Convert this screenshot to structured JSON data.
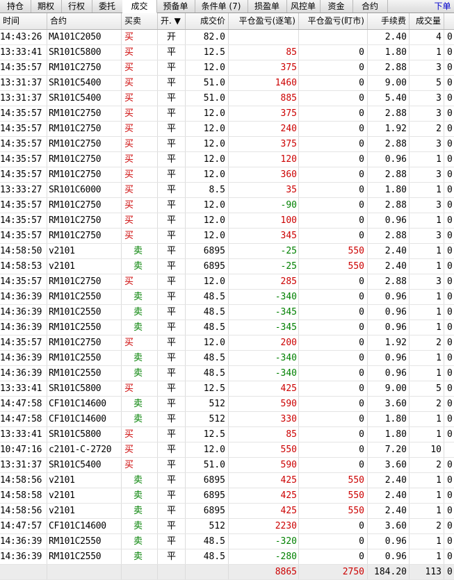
{
  "tabs": [
    {
      "label": "持仓",
      "active": false
    },
    {
      "label": "期权",
      "active": false
    },
    {
      "label": "行权",
      "active": false
    },
    {
      "label": "委托",
      "active": false
    },
    {
      "label": "成交",
      "active": true
    },
    {
      "label": "预备单",
      "active": false
    },
    {
      "label": "条件单 (7)",
      "active": false
    },
    {
      "label": "损盈单",
      "active": false
    },
    {
      "label": "风控单",
      "active": false
    },
    {
      "label": "资金",
      "active": false
    },
    {
      "label": "合约",
      "active": false
    }
  ],
  "order_link": "下单",
  "columns": {
    "time": "时间",
    "contract": "合约",
    "side": "买卖",
    "open_close": "开. ▼",
    "price": "成交价",
    "pnl_each": "平仓盈亏(逐笔)",
    "pnl_mark": "平仓盈亏(盯市)",
    "fee": "手续费",
    "volume": "成交量"
  },
  "colors": {
    "buy": "#cc0000",
    "sell": "#008000",
    "profit": "#cc0000",
    "loss": "#008000"
  },
  "rows": [
    {
      "time": "14:43:26",
      "contract": "MA101C2050",
      "side": "买",
      "oc": "开",
      "price": "82.0",
      "pnl1": "",
      "pnl2": "",
      "fee": "2.40",
      "vol": "4",
      "extra": "0"
    },
    {
      "time": "13:33:41",
      "contract": "SR101C5800",
      "side": "买",
      "oc": "平",
      "price": "12.5",
      "pnl1": "85",
      "pnl2": "0",
      "fee": "1.80",
      "vol": "1",
      "extra": "0"
    },
    {
      "time": "14:35:57",
      "contract": "RM101C2750",
      "side": "买",
      "oc": "平",
      "price": "12.0",
      "pnl1": "375",
      "pnl2": "0",
      "fee": "2.88",
      "vol": "3",
      "extra": "0"
    },
    {
      "time": "13:31:37",
      "contract": "SR101C5400",
      "side": "买",
      "oc": "平",
      "price": "51.0",
      "pnl1": "1460",
      "pnl2": "0",
      "fee": "9.00",
      "vol": "5",
      "extra": "0"
    },
    {
      "time": "13:31:37",
      "contract": "SR101C5400",
      "side": "买",
      "oc": "平",
      "price": "51.0",
      "pnl1": "885",
      "pnl2": "0",
      "fee": "5.40",
      "vol": "3",
      "extra": "0"
    },
    {
      "time": "14:35:57",
      "contract": "RM101C2750",
      "side": "买",
      "oc": "平",
      "price": "12.0",
      "pnl1": "375",
      "pnl2": "0",
      "fee": "2.88",
      "vol": "3",
      "extra": "0"
    },
    {
      "time": "14:35:57",
      "contract": "RM101C2750",
      "side": "买",
      "oc": "平",
      "price": "12.0",
      "pnl1": "240",
      "pnl2": "0",
      "fee": "1.92",
      "vol": "2",
      "extra": "0"
    },
    {
      "time": "14:35:57",
      "contract": "RM101C2750",
      "side": "买",
      "oc": "平",
      "price": "12.0",
      "pnl1": "375",
      "pnl2": "0",
      "fee": "2.88",
      "vol": "3",
      "extra": "0"
    },
    {
      "time": "14:35:57",
      "contract": "RM101C2750",
      "side": "买",
      "oc": "平",
      "price": "12.0",
      "pnl1": "120",
      "pnl2": "0",
      "fee": "0.96",
      "vol": "1",
      "extra": "0"
    },
    {
      "time": "14:35:57",
      "contract": "RM101C2750",
      "side": "买",
      "oc": "平",
      "price": "12.0",
      "pnl1": "360",
      "pnl2": "0",
      "fee": "2.88",
      "vol": "3",
      "extra": "0"
    },
    {
      "time": "13:33:27",
      "contract": "SR101C6000",
      "side": "买",
      "oc": "平",
      "price": "8.5",
      "pnl1": "35",
      "pnl2": "0",
      "fee": "1.80",
      "vol": "1",
      "extra": "0"
    },
    {
      "time": "14:35:57",
      "contract": "RM101C2750",
      "side": "买",
      "oc": "平",
      "price": "12.0",
      "pnl1": "-90",
      "pnl2": "0",
      "fee": "2.88",
      "vol": "3",
      "extra": "0"
    },
    {
      "time": "14:35:57",
      "contract": "RM101C2750",
      "side": "买",
      "oc": "平",
      "price": "12.0",
      "pnl1": "100",
      "pnl2": "0",
      "fee": "0.96",
      "vol": "1",
      "extra": "0"
    },
    {
      "time": "14:35:57",
      "contract": "RM101C2750",
      "side": "买",
      "oc": "平",
      "price": "12.0",
      "pnl1": "345",
      "pnl2": "0",
      "fee": "2.88",
      "vol": "3",
      "extra": "0"
    },
    {
      "time": "14:58:50",
      "contract": "v2101",
      "side": "卖",
      "oc": "平",
      "price": "6895",
      "pnl1": "-25",
      "pnl2": "550",
      "fee": "2.40",
      "vol": "1",
      "extra": "0"
    },
    {
      "time": "14:58:53",
      "contract": "v2101",
      "side": "卖",
      "oc": "平",
      "price": "6895",
      "pnl1": "-25",
      "pnl2": "550",
      "fee": "2.40",
      "vol": "1",
      "extra": "0"
    },
    {
      "time": "14:35:57",
      "contract": "RM101C2750",
      "side": "买",
      "oc": "平",
      "price": "12.0",
      "pnl1": "285",
      "pnl2": "0",
      "fee": "2.88",
      "vol": "3",
      "extra": "0"
    },
    {
      "time": "14:36:39",
      "contract": "RM101C2550",
      "side": "卖",
      "oc": "平",
      "price": "48.5",
      "pnl1": "-340",
      "pnl2": "0",
      "fee": "0.96",
      "vol": "1",
      "extra": "0"
    },
    {
      "time": "14:36:39",
      "contract": "RM101C2550",
      "side": "卖",
      "oc": "平",
      "price": "48.5",
      "pnl1": "-345",
      "pnl2": "0",
      "fee": "0.96",
      "vol": "1",
      "extra": "0"
    },
    {
      "time": "14:36:39",
      "contract": "RM101C2550",
      "side": "卖",
      "oc": "平",
      "price": "48.5",
      "pnl1": "-345",
      "pnl2": "0",
      "fee": "0.96",
      "vol": "1",
      "extra": "0"
    },
    {
      "time": "14:35:57",
      "contract": "RM101C2750",
      "side": "买",
      "oc": "平",
      "price": "12.0",
      "pnl1": "200",
      "pnl2": "0",
      "fee": "1.92",
      "vol": "2",
      "extra": "0"
    },
    {
      "time": "14:36:39",
      "contract": "RM101C2550",
      "side": "卖",
      "oc": "平",
      "price": "48.5",
      "pnl1": "-340",
      "pnl2": "0",
      "fee": "0.96",
      "vol": "1",
      "extra": "0"
    },
    {
      "time": "14:36:39",
      "contract": "RM101C2550",
      "side": "卖",
      "oc": "平",
      "price": "48.5",
      "pnl1": "-340",
      "pnl2": "0",
      "fee": "0.96",
      "vol": "1",
      "extra": "0"
    },
    {
      "time": "13:33:41",
      "contract": "SR101C5800",
      "side": "买",
      "oc": "平",
      "price": "12.5",
      "pnl1": "425",
      "pnl2": "0",
      "fee": "9.00",
      "vol": "5",
      "extra": "0"
    },
    {
      "time": "14:47:58",
      "contract": "CF101C14600",
      "side": "卖",
      "oc": "平",
      "price": "512",
      "pnl1": "590",
      "pnl2": "0",
      "fee": "3.60",
      "vol": "2",
      "extra": "0"
    },
    {
      "time": "14:47:58",
      "contract": "CF101C14600",
      "side": "卖",
      "oc": "平",
      "price": "512",
      "pnl1": "330",
      "pnl2": "0",
      "fee": "1.80",
      "vol": "1",
      "extra": "0"
    },
    {
      "time": "13:33:41",
      "contract": "SR101C5800",
      "side": "买",
      "oc": "平",
      "price": "12.5",
      "pnl1": "85",
      "pnl2": "0",
      "fee": "1.80",
      "vol": "1",
      "extra": "0"
    },
    {
      "time": "10:47:16",
      "contract": "c2101-C-2720",
      "side": "买",
      "oc": "平",
      "price": "12.0",
      "pnl1": "550",
      "pnl2": "0",
      "fee": "7.20",
      "vol": "10",
      "extra": ""
    },
    {
      "time": "13:31:37",
      "contract": "SR101C5400",
      "side": "买",
      "oc": "平",
      "price": "51.0",
      "pnl1": "590",
      "pnl2": "0",
      "fee": "3.60",
      "vol": "2",
      "extra": "0"
    },
    {
      "time": "14:58:56",
      "contract": "v2101",
      "side": "卖",
      "oc": "平",
      "price": "6895",
      "pnl1": "425",
      "pnl2": "550",
      "fee": "2.40",
      "vol": "1",
      "extra": "0"
    },
    {
      "time": "14:58:58",
      "contract": "v2101",
      "side": "卖",
      "oc": "平",
      "price": "6895",
      "pnl1": "425",
      "pnl2": "550",
      "fee": "2.40",
      "vol": "1",
      "extra": "0"
    },
    {
      "time": "14:58:56",
      "contract": "v2101",
      "side": "卖",
      "oc": "平",
      "price": "6895",
      "pnl1": "425",
      "pnl2": "550",
      "fee": "2.40",
      "vol": "1",
      "extra": "0"
    },
    {
      "time": "14:47:57",
      "contract": "CF101C14600",
      "side": "卖",
      "oc": "平",
      "price": "512",
      "pnl1": "2230",
      "pnl2": "0",
      "fee": "3.60",
      "vol": "2",
      "extra": "0"
    },
    {
      "time": "14:36:39",
      "contract": "RM101C2550",
      "side": "卖",
      "oc": "平",
      "price": "48.5",
      "pnl1": "-320",
      "pnl2": "0",
      "fee": "0.96",
      "vol": "1",
      "extra": "0"
    },
    {
      "time": "14:36:39",
      "contract": "RM101C2550",
      "side": "卖",
      "oc": "平",
      "price": "48.5",
      "pnl1": "-280",
      "pnl2": "0",
      "fee": "0.96",
      "vol": "1",
      "extra": "0"
    }
  ],
  "summary": {
    "pnl1": "8865",
    "pnl2": "2750",
    "fee": "184.20",
    "vol": "113",
    "extra": "0"
  }
}
